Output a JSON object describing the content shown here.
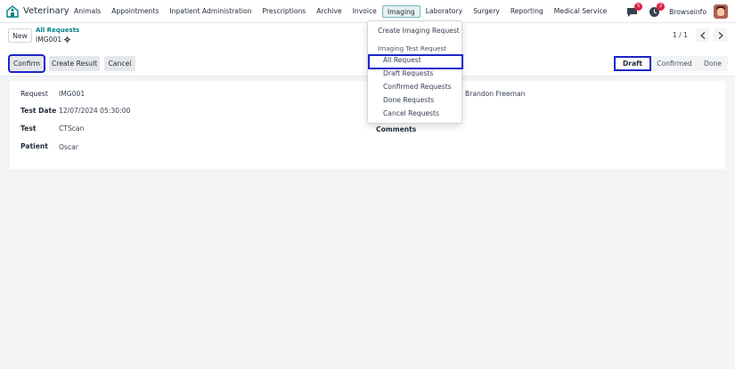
{
  "navbar": {
    "app_name": "Veterinary",
    "menu": [
      "Animals",
      "Appointments",
      "Inpatient Administration",
      "Prescriptions",
      "Archive",
      "Invoice",
      "Imaging",
      "Laboratory",
      "Surgery",
      "Reporting",
      "Medical Service"
    ],
    "active_menu": "Imaging",
    "messages_badge": "5",
    "activity_badge": "2",
    "user_name": "Browseinfo"
  },
  "control_panel": {
    "new_label": "New",
    "breadcrumb": "All Requests",
    "record_name": "IMG001",
    "pager": "1 / 1",
    "actions": {
      "confirm": "Confirm",
      "create_result": "Create Result",
      "cancel": "Cancel"
    },
    "status": {
      "draft": "Draft",
      "confirmed": "Confirmed",
      "done": "Done"
    }
  },
  "form": {
    "request_label": "Request",
    "request_value": "IMG001",
    "test_date_label": "Test Date",
    "test_date_value": "12/07/2024 05:30:00",
    "test_label": "Test",
    "test_value": "CTScan",
    "patient_label": "Patient",
    "patient_value": "Oscar",
    "doctor_value": "Brandon Freeman",
    "comments_label": "Comments"
  },
  "dropdown": {
    "create_label": "Create Imaging Request",
    "section_label": "Imaging Test Request",
    "items": [
      "All Request",
      "Draft Requests",
      "Confirmed Requests",
      "Done Requests",
      "Cancel Requests"
    ]
  },
  "colors": {
    "accent": "#017e84",
    "highlight": "#1d24c9",
    "badge": "#e11d48"
  }
}
